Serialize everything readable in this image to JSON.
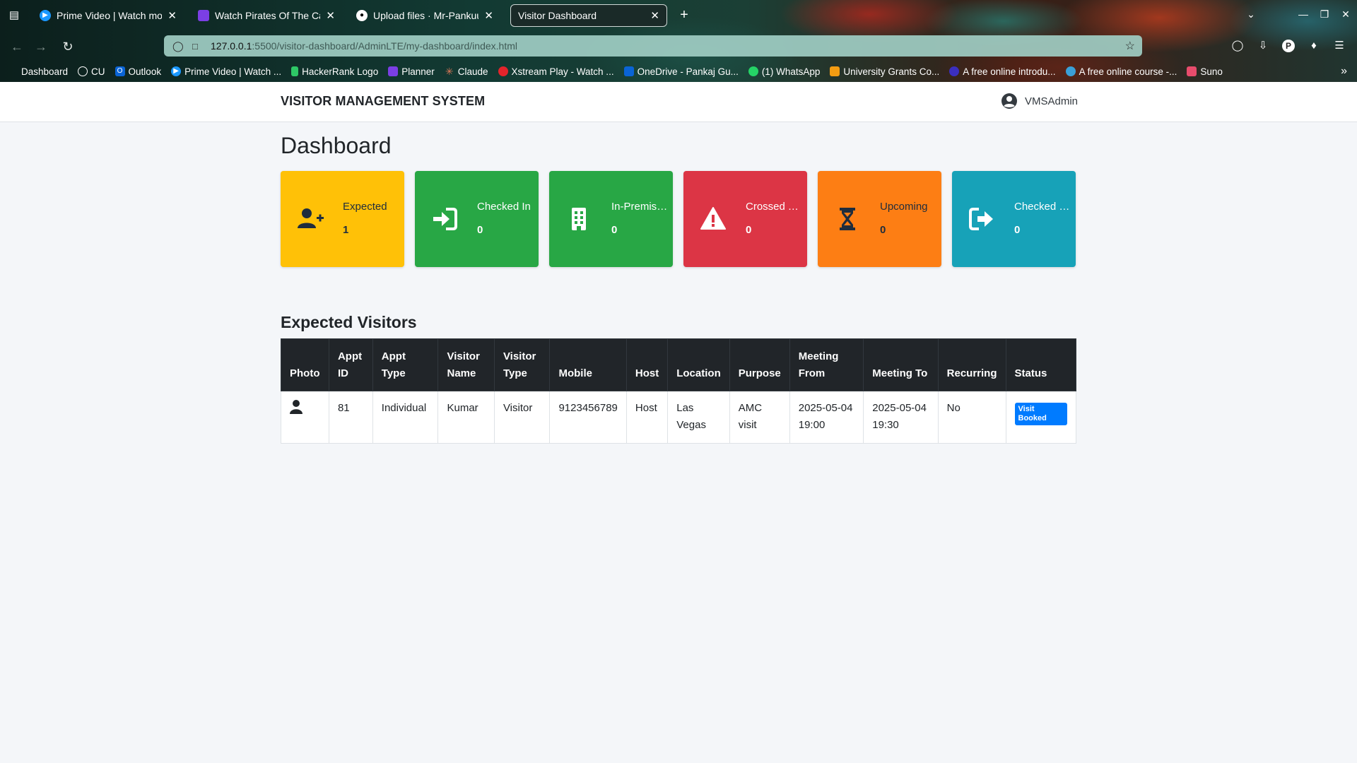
{
  "browser": {
    "tabs": [
      {
        "title": "Prime Video | Watch movies",
        "favicon_color": "#1a98ff",
        "active": false
      },
      {
        "title": "Watch Pirates Of The Caribbean",
        "favicon_color": "#7b3fe4",
        "active": false
      },
      {
        "title": "Upload files · Mr-Pankuu/F",
        "favicon_color": "#000000",
        "active": false
      },
      {
        "title": "Visitor Dashboard",
        "favicon_color": "",
        "active": true
      }
    ],
    "url_host": "127.0.0.1",
    "url_path": ":5500/visitor-dashboard/AdminLTE/my-dashboard/index.html",
    "bookmarks": [
      {
        "label": "Dashboard",
        "icon_color": ""
      },
      {
        "label": "CU",
        "icon_color": "#ffffff"
      },
      {
        "label": "Outlook",
        "icon_color": "#0a64d6"
      },
      {
        "label": "Prime Video | Watch ...",
        "icon_color": "#1a98ff"
      },
      {
        "label": "HackerRank Logo",
        "icon_color": "#2ec866"
      },
      {
        "label": "Planner",
        "icon_color": "#7b3fe4"
      },
      {
        "label": "Claude",
        "icon_color": "#d97757"
      },
      {
        "label": "Xstream Play - Watch ...",
        "icon_color": "#e4242b"
      },
      {
        "label": "OneDrive - Pankaj Gu...",
        "icon_color": "#0a64d6"
      },
      {
        "label": "(1) WhatsApp",
        "icon_color": "#25d366"
      },
      {
        "label": "University Grants Co...",
        "icon_color": "#f39c12"
      },
      {
        "label": "A free online introdu...",
        "icon_color": "#3b2fbf"
      },
      {
        "label": "A free online course -...",
        "icon_color": "#3aa0d8"
      },
      {
        "label": "Suno",
        "icon_color": "#e74c6c"
      }
    ]
  },
  "app": {
    "brand": "VISITOR MANAGEMENT SYSTEM",
    "user": "VMSAdmin",
    "page_title": "Dashboard",
    "cards": [
      {
        "label": "Expected",
        "count": "1",
        "color": "#ffc107",
        "text_color": "#1f2d3d",
        "icon": "user-plus-icon"
      },
      {
        "label": "Checked In",
        "count": "0",
        "color": "#28a745",
        "text_color": "#ffffff",
        "icon": "sign-in-icon"
      },
      {
        "label": "In-Premises",
        "count": "0",
        "color": "#28a745",
        "text_color": "#ffffff",
        "icon": "building-icon"
      },
      {
        "label": "Crossed Time",
        "count": "0",
        "color": "#dc3545",
        "text_color": "#ffffff",
        "icon": "warning-icon"
      },
      {
        "label": "Upcoming",
        "count": "0",
        "color": "#fd7e14",
        "text_color": "#1f2d3d",
        "icon": "hourglass-icon"
      },
      {
        "label": "Checked Out",
        "count": "0",
        "color": "#17a2b8",
        "text_color": "#ffffff",
        "icon": "sign-out-icon"
      }
    ],
    "section_title": "Expected Visitors",
    "table": {
      "headers": [
        "Photo",
        "Appt ID",
        "Appt Type",
        "Visitor Name",
        "Visitor Type",
        "Mobile",
        "Host",
        "Location",
        "Purpose",
        "Meeting From",
        "Meeting To",
        "Recurring",
        "Status"
      ],
      "rows": [
        {
          "photo": "user-icon",
          "appt_id": "81",
          "appt_type": "Individual",
          "visitor_name": "Kumar",
          "visitor_type": "Visitor",
          "mobile": "9123456789",
          "host": "Host",
          "location": "Las Vegas",
          "purpose": "AMC visit",
          "meeting_from": "2025-05-04 19:00",
          "meeting_to": "2025-05-04 19:30",
          "recurring": "No",
          "status": "Visit Booked"
        }
      ]
    }
  }
}
